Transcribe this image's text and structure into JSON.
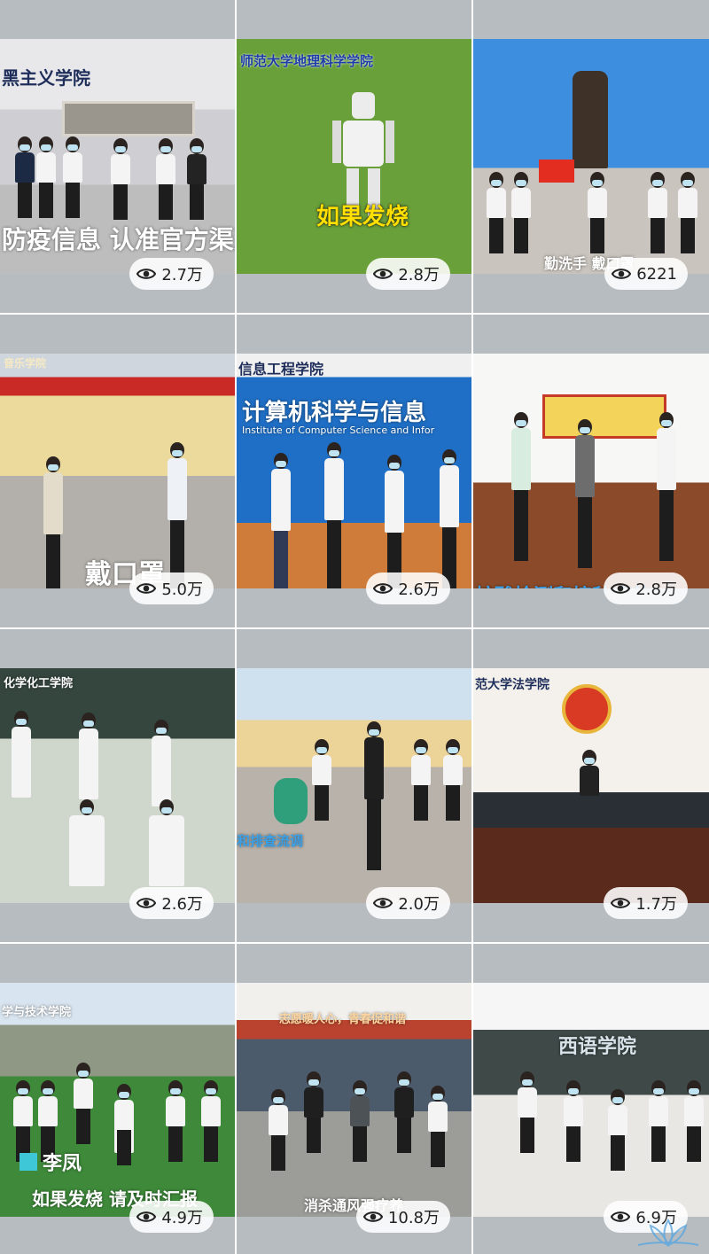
{
  "tiles": [
    {
      "overlay": "防疫信息 认准官方渠道",
      "caption_top": "黑主义学院",
      "views": "2.7万"
    },
    {
      "overlay": "如果发烧",
      "caption_top": "师范大学地理科学学院",
      "views": "2.8万"
    },
    {
      "overlay": "勤洗手 戴口罩",
      "caption_top": "",
      "views": "6221"
    },
    {
      "overlay": "戴口罩",
      "caption_top": "音乐学院",
      "views": "5.0万"
    },
    {
      "overlay": "计算机科学与信息",
      "caption_top": "信息工程学院",
      "subtitle": "Institute of Computer Science and Infor",
      "views": "2.6万"
    },
    {
      "overlay": "核酸检测和接种疫苗",
      "caption_top": "",
      "views": "2.8万"
    },
    {
      "overlay": "",
      "caption_top": "化学化工学院",
      "views": "2.6万"
    },
    {
      "overlay": "和排查流调",
      "caption_top": "",
      "views": "2.0万"
    },
    {
      "overlay": "",
      "caption_top": "范大学法学院",
      "views": "1.7万"
    },
    {
      "overlay": "如果发烧 请及时汇报",
      "caption_top": "学与技术学院",
      "name_tag": "李凤",
      "views": "4.9万"
    },
    {
      "overlay": "消杀通风强疗养",
      "caption_top": "志愿暖人心，青春促和谐",
      "views": "10.8万"
    },
    {
      "overlay": "",
      "caption_top": "西语学院",
      "views": "6.9万"
    }
  ],
  "colors": {
    "bar_gray": "#b7bcc1",
    "pill_bg": "#ffffff",
    "overlay_yellow": "#ffe000"
  },
  "icons": {
    "views": "eye-icon",
    "watermark": "lotus-watermark-icon"
  }
}
